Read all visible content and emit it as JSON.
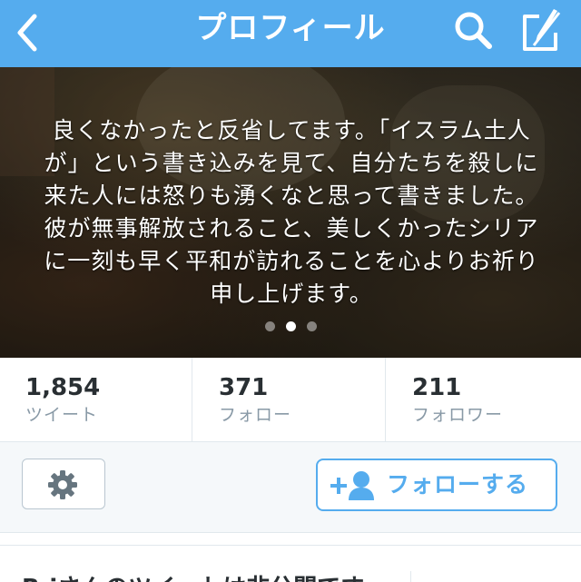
{
  "nav": {
    "title": "プロフィール",
    "back_icon": "chevron-left-icon",
    "search_icon": "search-icon",
    "compose_icon": "compose-icon",
    "bar_color": "#55acee"
  },
  "banner": {
    "bio": "良くなかったと反省してます。「イスラム土人が」という書き込みを見て、自分たちを殺しに来た人には怒りも湧くなと思って書きました。彼が無事解放されること、美しくかったシリアに一刻も早く平和が訪れることを心よりお祈り申し上げます。",
    "page_count": 3,
    "active_page": 2
  },
  "stats": [
    {
      "value": "1,854",
      "label": "ツイート"
    },
    {
      "value": "371",
      "label": "フォロー"
    },
    {
      "value": "211",
      "label": "フォロワー"
    }
  ],
  "actions": {
    "settings_icon": "gear-icon",
    "follow_icon": "add-user-icon",
    "follow_label": "フォローする",
    "accent_color": "#55acee"
  },
  "notice": {
    "text": "R.iさんのツイートは非公開です"
  }
}
